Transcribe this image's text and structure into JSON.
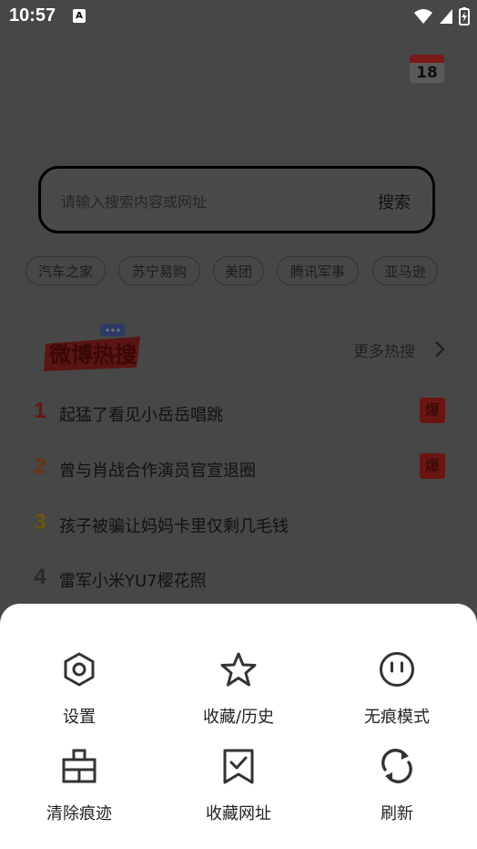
{
  "status_bar": {
    "time": "10:57",
    "notification_icon": "A"
  },
  "calendar": {
    "day": "18"
  },
  "search": {
    "placeholder": "请输入搜索内容或网址",
    "button_label": "搜索"
  },
  "quick_links": [
    {
      "label": "汽车之家"
    },
    {
      "label": "苏宁易购"
    },
    {
      "label": "美团"
    },
    {
      "label": "腾讯军事"
    },
    {
      "label": "亚马逊"
    }
  ],
  "hot_search": {
    "logo_text": "微博热搜",
    "more_label": "更多热搜",
    "items": [
      {
        "rank": "1",
        "title": "起猛了看见小岳岳唱跳",
        "badge": "爆",
        "rank_color": "#6b1410"
      },
      {
        "rank": "2",
        "title": "曾与肖战合作演员官宣退圈",
        "badge": "爆",
        "rank_color": "#6b3410"
      },
      {
        "rank": "3",
        "title": "孩子被骗让妈妈卡里仅剩几毛钱",
        "badge": "",
        "rank_color": "#6b5510"
      },
      {
        "rank": "4",
        "title": "雷军小米YU7樱花照",
        "badge": "",
        "rank_color": "#2a2a2a"
      }
    ]
  },
  "menu": {
    "items": [
      {
        "label": "设置",
        "icon": "settings-icon"
      },
      {
        "label": "收藏/历史",
        "icon": "star-icon"
      },
      {
        "label": "无痕模式",
        "icon": "incognito-face-icon"
      },
      {
        "label": "清除痕迹",
        "icon": "clear-traces-icon"
      },
      {
        "label": "收藏网址",
        "icon": "bookmark-check-icon"
      },
      {
        "label": "刷新",
        "icon": "refresh-icon"
      }
    ]
  },
  "colors": {
    "overlay": "#000000",
    "sheet": "#ffffff",
    "icon_stroke": "#333333",
    "badge": "#6a1511"
  }
}
